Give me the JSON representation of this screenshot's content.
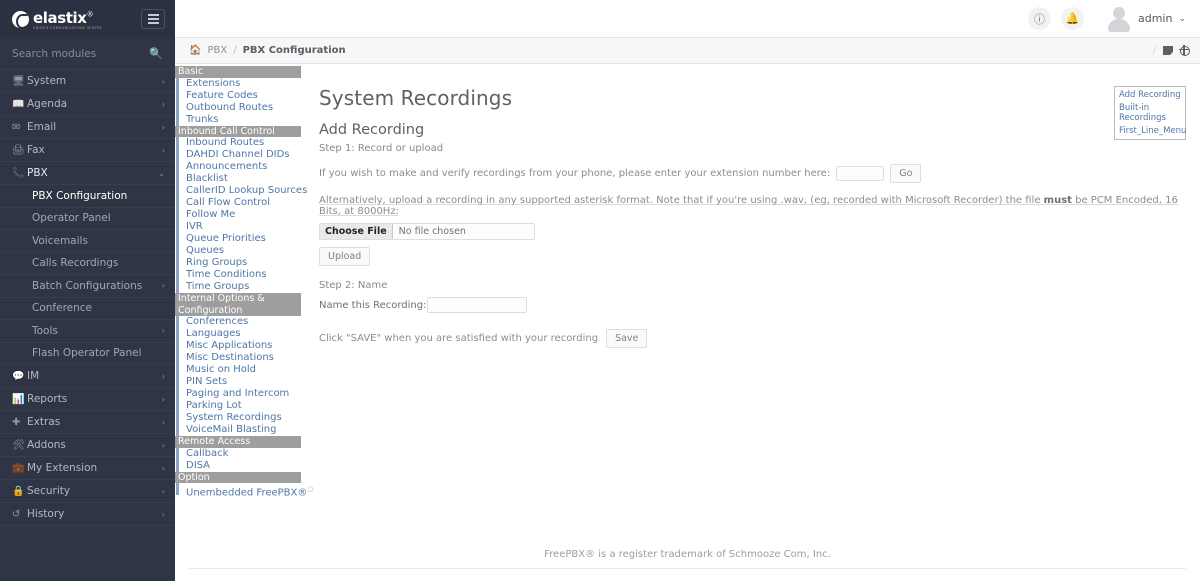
{
  "brand": {
    "name": "elastix",
    "reg": "®",
    "tagline": "UNIFIED COMMUNICATIONS SERVER",
    "menu_icon": "hamburger-icon"
  },
  "search": {
    "placeholder": "Search modules",
    "value": "",
    "icon": "search-icon"
  },
  "sidebar": {
    "items": [
      {
        "label": "System",
        "icon": "monitor-icon",
        "chevron": "›",
        "expanded": false
      },
      {
        "label": "Agenda",
        "icon": "book-icon",
        "chevron": "›",
        "expanded": false
      },
      {
        "label": "Email",
        "icon": "envelope-icon",
        "chevron": "›",
        "expanded": false
      },
      {
        "label": "Fax",
        "icon": "printer-icon",
        "chevron": "›",
        "expanded": false
      },
      {
        "label": "PBX",
        "icon": "phone-icon",
        "chevron": "⌄",
        "expanded": true
      },
      {
        "label": "IM",
        "icon": "chat-icon",
        "chevron": "›",
        "expanded": false
      },
      {
        "label": "Reports",
        "icon": "chart-icon",
        "chevron": "›",
        "expanded": false
      },
      {
        "label": "Extras",
        "icon": "plus-icon",
        "chevron": "›",
        "expanded": false
      },
      {
        "label": "Addons",
        "icon": "puzzle-icon",
        "chevron": "›",
        "expanded": false
      },
      {
        "label": "My Extension",
        "icon": "briefcase-icon",
        "chevron": "›",
        "expanded": false
      },
      {
        "label": "Security",
        "icon": "lock-icon",
        "chevron": "›",
        "expanded": false
      },
      {
        "label": "History",
        "icon": "history-icon",
        "chevron": "›",
        "expanded": false
      }
    ],
    "pbx_children": [
      {
        "label": "PBX Configuration",
        "active": true,
        "chevron": ""
      },
      {
        "label": "Operator Panel",
        "active": false,
        "chevron": ""
      },
      {
        "label": "Voicemails",
        "active": false,
        "chevron": ""
      },
      {
        "label": "Calls Recordings",
        "active": false,
        "chevron": ""
      },
      {
        "label": "Batch Configurations",
        "active": false,
        "chevron": "›"
      },
      {
        "label": "Conference",
        "active": false,
        "chevron": ""
      },
      {
        "label": "Tools",
        "active": false,
        "chevron": "›"
      },
      {
        "label": "Flash Operator Panel",
        "active": false,
        "chevron": ""
      }
    ]
  },
  "topbar": {
    "info_icon": "info-icon",
    "bell_icon": "bell-icon",
    "avatar_icon": "user-avatar-icon",
    "user_name": "admin",
    "caret": "⌄"
  },
  "breadcrumb": {
    "home_icon": "home-icon",
    "items": [
      "PBX",
      "PBX Configuration"
    ],
    "separator": "/",
    "right_slash": "/",
    "right_icons": [
      "note-icon",
      "globe-icon"
    ]
  },
  "fpbx_menu": [
    {
      "type": "header",
      "label": "Basic"
    },
    {
      "type": "link",
      "label": "Extensions"
    },
    {
      "type": "link",
      "label": "Feature Codes"
    },
    {
      "type": "link",
      "label": "Outbound Routes"
    },
    {
      "type": "link",
      "label": "Trunks"
    },
    {
      "type": "header",
      "label": "Inbound Call Control"
    },
    {
      "type": "link",
      "label": "Inbound Routes"
    },
    {
      "type": "link",
      "label": "DAHDI Channel DIDs"
    },
    {
      "type": "link",
      "label": "Announcements"
    },
    {
      "type": "link",
      "label": "Blacklist"
    },
    {
      "type": "link",
      "label": "CallerID Lookup Sources"
    },
    {
      "type": "link",
      "label": "Call Flow Control"
    },
    {
      "type": "link",
      "label": "Follow Me"
    },
    {
      "type": "link",
      "label": "IVR"
    },
    {
      "type": "link",
      "label": "Queue Priorities"
    },
    {
      "type": "link",
      "label": "Queues"
    },
    {
      "type": "link",
      "label": "Ring Groups"
    },
    {
      "type": "link",
      "label": "Time Conditions"
    },
    {
      "type": "link",
      "label": "Time Groups"
    },
    {
      "type": "header",
      "label": "Internal Options & Configuration"
    },
    {
      "type": "link",
      "label": "Conferences"
    },
    {
      "type": "link",
      "label": "Languages"
    },
    {
      "type": "link",
      "label": "Misc Applications"
    },
    {
      "type": "link",
      "label": "Misc Destinations"
    },
    {
      "type": "link",
      "label": "Music on Hold"
    },
    {
      "type": "link",
      "label": "PIN Sets"
    },
    {
      "type": "link",
      "label": "Paging and Intercom"
    },
    {
      "type": "link",
      "label": "Parking Lot"
    },
    {
      "type": "link",
      "label": "System Recordings"
    },
    {
      "type": "link",
      "label": "VoiceMail Blasting"
    },
    {
      "type": "header",
      "label": "Remote Access"
    },
    {
      "type": "link",
      "label": "Callback"
    },
    {
      "type": "link",
      "label": "DISA"
    },
    {
      "type": "header",
      "label": "Option"
    },
    {
      "type": "link",
      "label": "Unembedded FreePBX®",
      "sup": "○"
    }
  ],
  "content": {
    "page_title": "System Recordings",
    "section_title": "Add Recording",
    "step1": "Step 1: Record or upload",
    "phone_line": "If you wish to make and verify recordings from your phone, please enter your extension number here:",
    "extension_value": "",
    "go_label": "Go",
    "alt_line_pre": "Alternatively, upload a recording in any supported asterisk format. Note that if you're using .wav, (eg, recorded with Microsoft Recorder) the file ",
    "alt_line_bold": "must",
    "alt_line_post": " be PCM Encoded, 16 Bits, at 8000Hz:",
    "choose_file_label": "Choose File",
    "file_status": "No file chosen",
    "upload_label": "Upload",
    "step2": "Step 2: Name",
    "name_label": "Name this Recording:",
    "name_value": "",
    "save_hint": "Click \"SAVE\" when you are satisfied with your recording",
    "save_label": "Save"
  },
  "right_box": {
    "links": [
      "Add Recording",
      "Built-in Recordings",
      "First_Line_Menu"
    ]
  },
  "footer": {
    "text": "FreePBX® is a register trademark of Schmooze Com, Inc."
  },
  "colors": {
    "sidebar_bg": "#2f3545",
    "link_blue": "#4d77a8",
    "header_gray": "#9e9e9e",
    "text_gray": "#5e6166"
  }
}
